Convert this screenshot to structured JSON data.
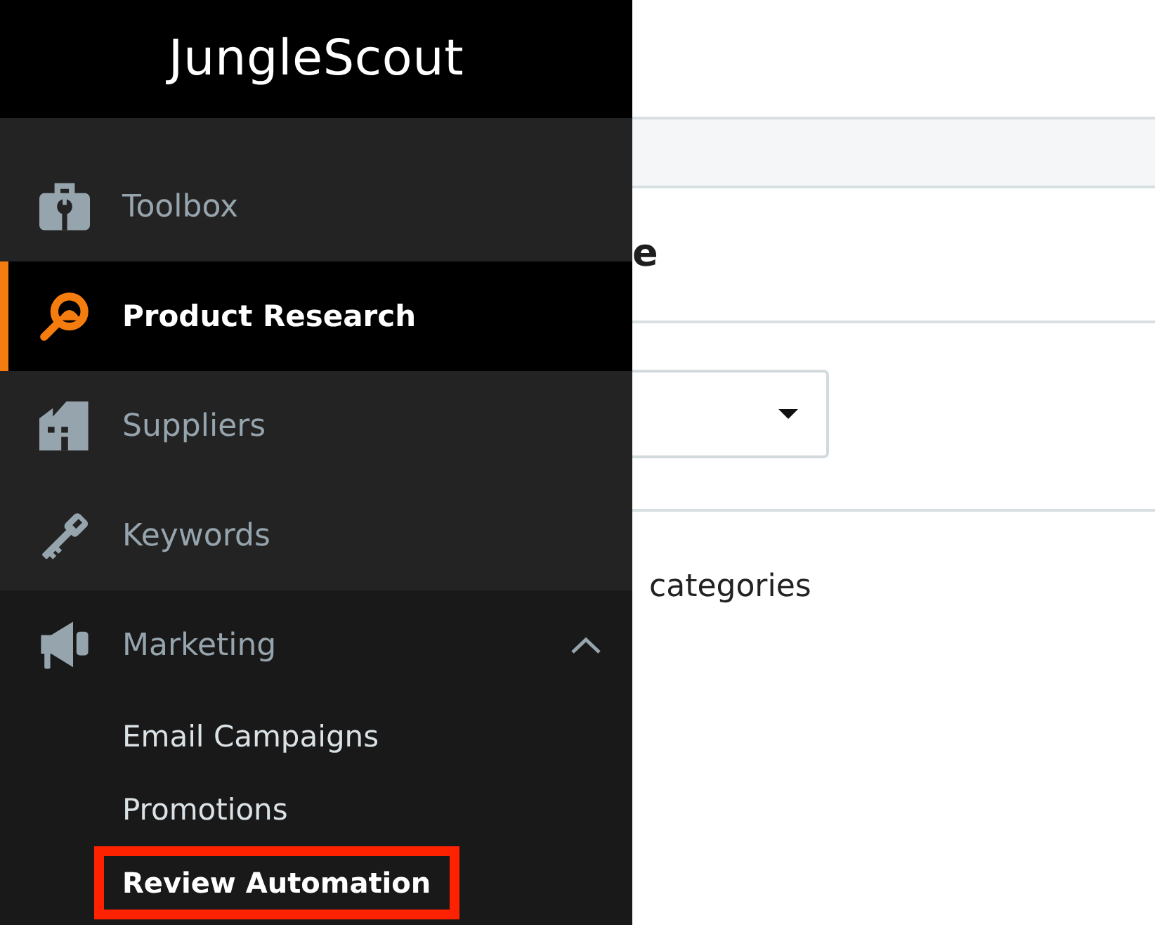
{
  "logo": {
    "text": "JungleScout"
  },
  "sidebar": {
    "items": [
      {
        "label": "Toolbox",
        "selected": false
      },
      {
        "label": "Product Research",
        "selected": true
      },
      {
        "label": "Suppliers",
        "selected": false
      },
      {
        "label": "Keywords",
        "selected": false
      },
      {
        "label": "Marketing",
        "selected": false,
        "expanded": true,
        "children": [
          {
            "label": "Email Campaigns",
            "selected": false,
            "highlighted": false
          },
          {
            "label": "Promotions",
            "selected": false,
            "highlighted": false
          },
          {
            "label": "Review Automation",
            "selected": true,
            "highlighted": true
          }
        ]
      }
    ]
  },
  "content": {
    "heading": "e",
    "text": "categories"
  }
}
